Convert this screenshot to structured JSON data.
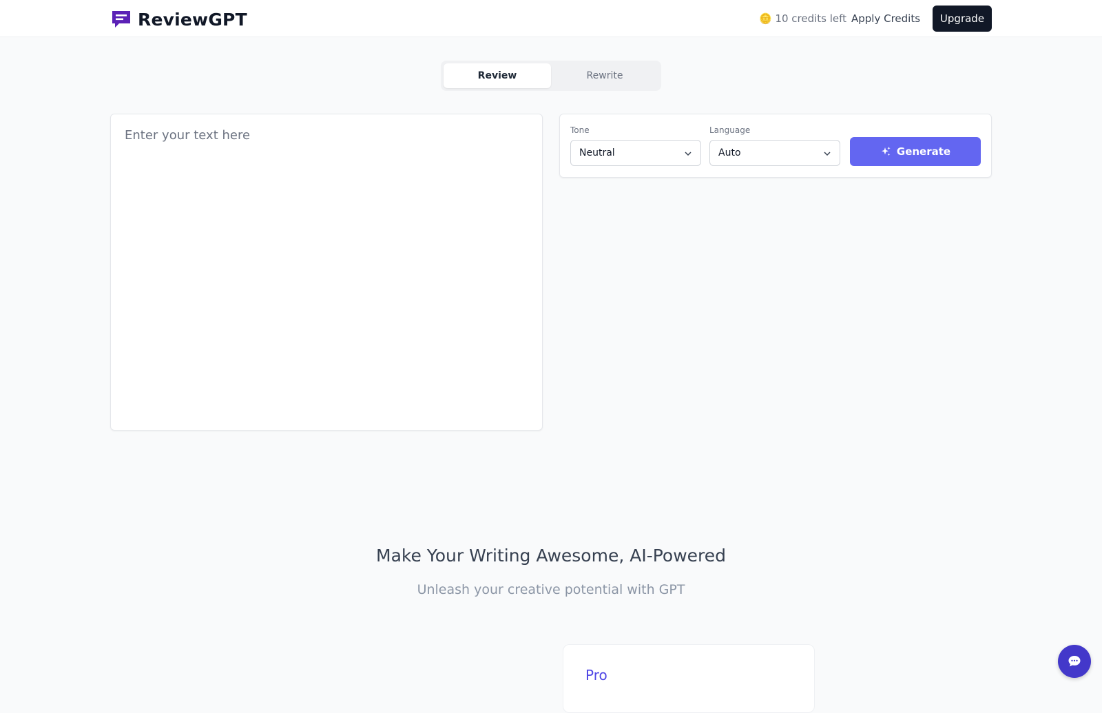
{
  "app": {
    "name": "ReviewGPT",
    "brand_color": "#5b21b6"
  },
  "header": {
    "credits_icon": "coin-icon",
    "credits_text": "🪙 10 credits left",
    "apply_credits_label": "Apply Credits",
    "upgrade_label": "Upgrade"
  },
  "tabs": [
    {
      "label": "Review",
      "active": true
    },
    {
      "label": "Rewrite",
      "active": false
    }
  ],
  "editor": {
    "placeholder": "Enter your text here",
    "value": ""
  },
  "controls": {
    "tone_label": "Tone",
    "tone_value": "Neutral",
    "language_label": "Language",
    "language_value": "Auto",
    "generate_label": "Generate",
    "accent_color": "#6366f1"
  },
  "hero": {
    "title": "Make Your Writing Awesome, AI-Powered",
    "subtitle": "Unleash your creative potential with GPT"
  },
  "pricing": {
    "plan_name": "Pro"
  }
}
